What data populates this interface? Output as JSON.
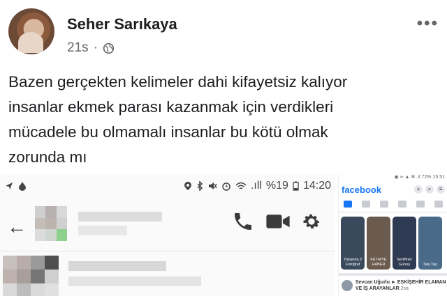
{
  "post": {
    "author": "Seher Sarıkaya",
    "time": "21s",
    "separator": "·",
    "privacy_icon": "globe-icon",
    "more_icon": "more-dots-icon",
    "more_label": "•••",
    "text": "Bazen gerçekten kelimeler dahi kifayetsiz kalıyor\ninsanlar ekmek parası kazanmak için verdikleri\nmücadele bu olmamalı insanlar bu kötü olmak\nzorunda mı"
  },
  "screenshot_messenger": {
    "status_bar": {
      "time": "14:20",
      "battery": "%19",
      "signal": ".ıll"
    },
    "back_icon": "arrow-left-icon",
    "back_label": "←",
    "call_icon": "phone-icon",
    "video_icon": "video-icon",
    "settings_icon": "gear-icon"
  },
  "screenshot_facebook": {
    "status_text": "◉ ∞ ▲ ✻ .ıl 72% 15:51",
    "logo": "facebook",
    "stories": [
      {
        "label": "Yukarıda 2 Fotoğraf",
        "color": "#3a4a5c"
      },
      {
        "label": "FETHİYE HABER",
        "color": "#6b5a4e"
      },
      {
        "label": "Sertifiner Güneş",
        "color": "#2f3b52"
      },
      {
        "label": "Sey Tay",
        "color": "#4a6a8a"
      }
    ],
    "post_author": "Sevcan Uğurlu",
    "post_arrow": "►",
    "post_group": "ESKİŞEHİR ELAMAN VE İŞ ARAYANLAR",
    "post_sub": "2sa"
  },
  "colors": {
    "fb_blue": "#1877f2",
    "text_primary": "#1c1e21",
    "text_secondary": "#65676b"
  }
}
